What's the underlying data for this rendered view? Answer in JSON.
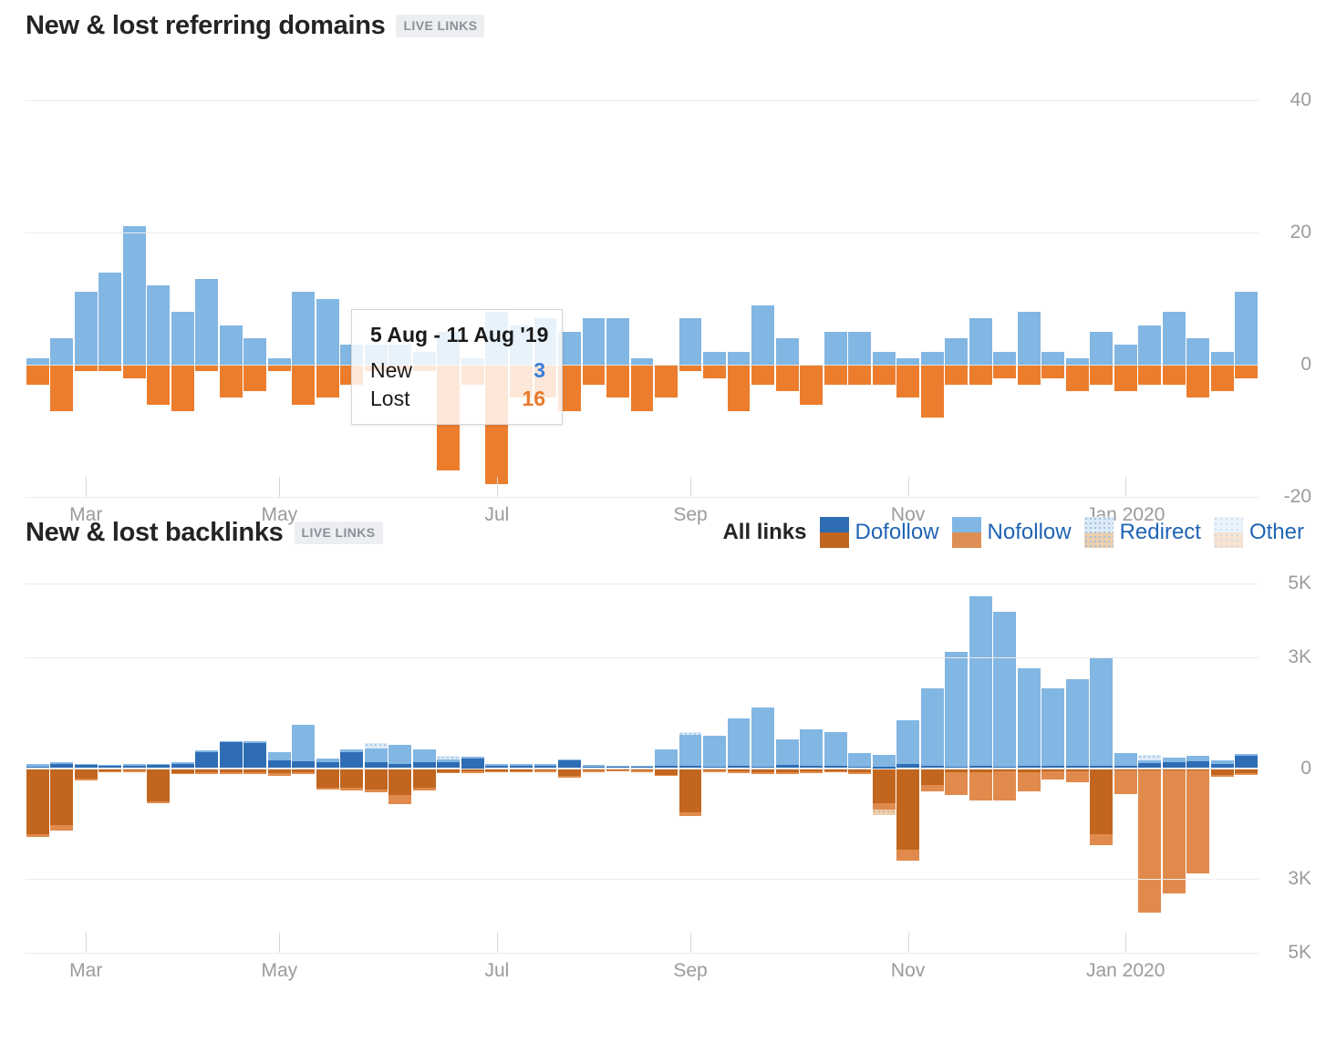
{
  "charts": {
    "referring_domains": {
      "title": "New & lost referring domains",
      "badge": "LIVE LINKS",
      "tooltip": {
        "title": "5 Aug - 11 Aug '19",
        "new_label": "New",
        "new_value": "3",
        "lost_label": "Lost",
        "lost_value": "16"
      }
    },
    "backlinks": {
      "title": "New & lost backlinks",
      "badge": "LIVE LINKS"
    }
  },
  "legend": {
    "all_links": "All links",
    "items": [
      {
        "label": "Dofollow",
        "swatch": "sw-dofollow",
        "color_pos": "#2e6db4",
        "color_neg": "#c2661f"
      },
      {
        "label": "Nofollow",
        "swatch": "sw-nofollow",
        "color_pos": "#82b6e3",
        "color_neg": "#dd8f55"
      },
      {
        "label": "Redirect",
        "swatch": "sw-redirect",
        "color_pos": "#dceaf7",
        "color_neg": "#eccfae"
      },
      {
        "label": "Other",
        "swatch": "sw-other",
        "color_pos": "#eaf3fb",
        "color_neg": "#f7e3d2"
      }
    ]
  },
  "colors": {
    "text": "#242424",
    "axis": "#9b9b9b",
    "grid": "#ececec",
    "link_blue": "#1f64b4",
    "new_blue": "#82b6e3",
    "lost_orange": "#ec7d2d"
  },
  "chart_data": [
    {
      "type": "bar",
      "title": "New & lost referring domains",
      "subtitle": "LIVE LINKS",
      "stacked": true,
      "diverging": true,
      "xlabel": "",
      "ylabel": "",
      "ylim": [
        -20,
        40
      ],
      "yticks": [
        40,
        20,
        0,
        -20
      ],
      "ytick_labels": [
        "40",
        "20",
        "0",
        "-20"
      ],
      "grid": true,
      "xticks": [
        2,
        10,
        19,
        27,
        36,
        45
      ],
      "xtick_labels": [
        "Mar",
        "May",
        "Jul",
        "Sep",
        "Nov",
        "Jan 2020"
      ],
      "legend_position": "none",
      "series": [
        {
          "name": "New",
          "color": "#82b6e3",
          "values": [
            1,
            4,
            11,
            14,
            21,
            12,
            8,
            13,
            6,
            4,
            1,
            11,
            10,
            3,
            3,
            3,
            2,
            5,
            1,
            8,
            6,
            7,
            5,
            7,
            7,
            1,
            0,
            7,
            2,
            2,
            9,
            4,
            0,
            5,
            5,
            2,
            1,
            2,
            4,
            7,
            2,
            8,
            2,
            1,
            5,
            3,
            6,
            8,
            4,
            2,
            11
          ]
        },
        {
          "name": "Lost",
          "color": "#ec7d2d",
          "values": [
            3,
            7,
            1,
            1,
            2,
            6,
            7,
            1,
            5,
            4,
            1,
            6,
            5,
            3,
            1,
            1,
            1,
            16,
            3,
            18,
            5,
            5,
            7,
            3,
            5,
            7,
            5,
            1,
            2,
            7,
            3,
            4,
            6,
            3,
            3,
            3,
            5,
            8,
            3,
            3,
            2,
            3,
            2,
            4,
            3,
            4,
            3,
            3,
            5,
            4,
            2
          ]
        }
      ]
    },
    {
      "type": "bar",
      "title": "New & lost backlinks",
      "subtitle": "LIVE LINKS",
      "stacked": true,
      "diverging": true,
      "xlabel": "",
      "ylabel": "",
      "ylim": [
        -5000,
        5000
      ],
      "yticks": [
        5000,
        3000,
        0,
        -3000,
        -5000
      ],
      "ytick_labels": [
        "5K",
        "3K",
        "0",
        "3K",
        "5K"
      ],
      "grid": true,
      "xticks": [
        2,
        10,
        19,
        27,
        36,
        45
      ],
      "xtick_labels": [
        "Mar",
        "May",
        "Jul",
        "Sep",
        "Nov",
        "Jan 2020"
      ],
      "legend_position": "top-right",
      "legend_entries": [
        "Dofollow",
        "Nofollow",
        "Redirect",
        "Other"
      ],
      "series": [
        {
          "name": "New Dofollow",
          "color": "#2e6db4",
          "values": [
            40,
            120,
            90,
            70,
            80,
            90,
            110,
            430,
            700,
            690,
            210,
            180,
            150,
            420,
            150,
            100,
            170,
            150,
            250,
            70,
            80,
            80,
            210,
            60,
            50,
            40,
            60,
            50,
            40,
            50,
            40,
            80,
            60,
            50,
            40,
            30,
            100,
            50,
            40,
            50,
            40,
            60,
            50,
            60,
            70,
            60,
            130,
            160,
            190,
            120,
            330
          ]
        },
        {
          "name": "New Nofollow",
          "color": "#82b6e3",
          "values": [
            60,
            40,
            30,
            20,
            20,
            30,
            40,
            60,
            40,
            50,
            220,
            1000,
            100,
            80,
            370,
            520,
            330,
            90,
            60,
            40,
            30,
            20,
            30,
            20,
            20,
            30,
            440,
            840,
            830,
            1300,
            1600,
            690,
            1000,
            930,
            370,
            320,
            1200,
            2100,
            3100,
            4600,
            4200,
            2650,
            2100,
            2350,
            2900,
            340,
            90,
            120,
            140,
            90,
            60
          ]
        },
        {
          "name": "New Redirect",
          "color": "#dceaf7",
          "values": [
            0,
            0,
            0,
            0,
            0,
            0,
            0,
            0,
            0,
            0,
            0,
            0,
            0,
            0,
            160,
            0,
            0,
            90,
            0,
            0,
            0,
            0,
            0,
            0,
            0,
            0,
            0,
            90,
            0,
            0,
            0,
            0,
            0,
            0,
            0,
            0,
            0,
            0,
            0,
            0,
            0,
            0,
            0,
            0,
            0,
            0,
            140,
            0,
            0,
            0,
            0
          ]
        },
        {
          "name": "Lost Dofollow",
          "color": "#c2661f",
          "values": [
            1800,
            1550,
            290,
            80,
            70,
            900,
            130,
            110,
            120,
            120,
            140,
            120,
            520,
            540,
            570,
            730,
            540,
            100,
            90,
            80,
            80,
            70,
            220,
            70,
            60,
            70,
            180,
            1200,
            70,
            80,
            100,
            110,
            90,
            80,
            120,
            950,
            2200,
            450,
            120,
            110,
            90,
            100,
            80,
            90,
            1800,
            70,
            60,
            50,
            60,
            180,
            130
          ]
        },
        {
          "name": "Lost Nofollow",
          "color": "#e08b4d",
          "values": [
            60,
            150,
            40,
            30,
            30,
            60,
            40,
            50,
            40,
            50,
            60,
            50,
            60,
            70,
            80,
            250,
            60,
            40,
            40,
            30,
            30,
            30,
            40,
            30,
            30,
            30,
            40,
            90,
            40,
            50,
            60,
            50,
            50,
            40,
            40,
            170,
            300,
            180,
            620,
            760,
            790,
            520,
            240,
            300,
            290,
            640,
            3850,
            3350,
            2800,
            60,
            50
          ]
        },
        {
          "name": "Lost Redirect",
          "color": "#eccfae",
          "values": [
            0,
            0,
            0,
            0,
            0,
            0,
            0,
            0,
            0,
            0,
            0,
            0,
            0,
            0,
            0,
            0,
            0,
            0,
            0,
            0,
            0,
            0,
            0,
            0,
            0,
            0,
            0,
            0,
            0,
            0,
            0,
            0,
            0,
            0,
            0,
            160,
            0,
            0,
            0,
            0,
            0,
            0,
            0,
            0,
            0,
            0,
            0,
            0,
            0,
            0,
            0
          ]
        }
      ]
    }
  ]
}
